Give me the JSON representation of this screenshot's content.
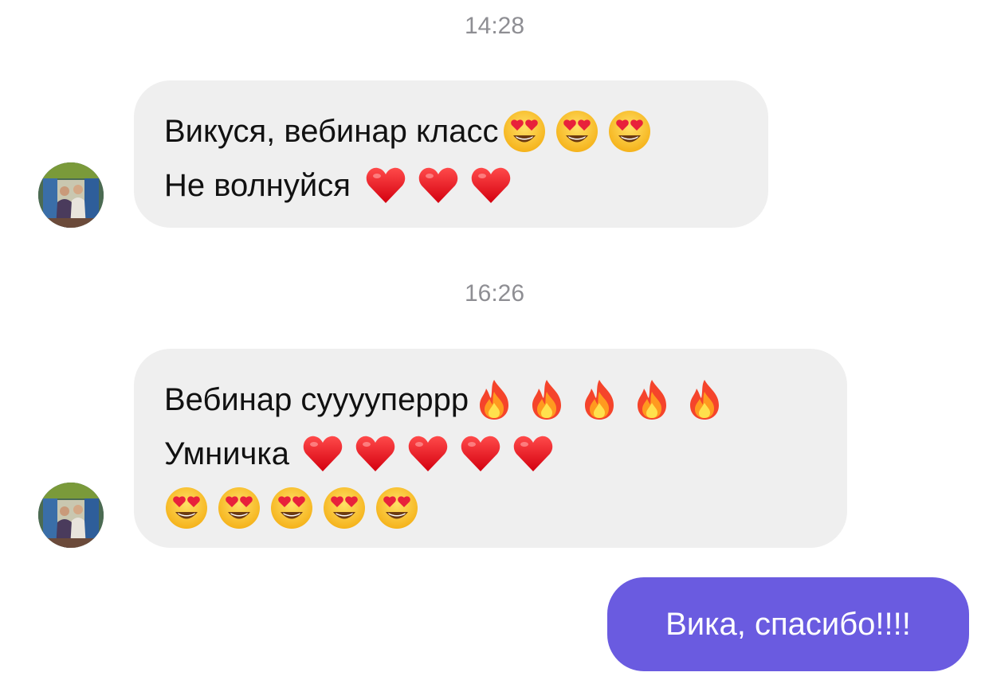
{
  "conversation": {
    "groups": [
      {
        "timestamp": "14:28",
        "message": {
          "lines": [
            {
              "text": "Викуся, вебинар класс",
              "emojis": [
                "heart-eyes-emoji",
                "heart-eyes-emoji",
                "heart-eyes-emoji"
              ]
            },
            {
              "text": "Не волнуйся",
              "emojis": [
                "red-heart-emoji",
                "red-heart-emoji",
                "red-heart-emoji"
              ]
            }
          ]
        }
      },
      {
        "timestamp": "16:26",
        "message": {
          "lines": [
            {
              "text": "Вебинар сууууперрр",
              "emojis": [
                "fire-emoji",
                "fire-emoji",
                "fire-emoji",
                "fire-emoji",
                "fire-emoji"
              ]
            },
            {
              "text": "Умничка",
              "emojis": [
                "red-heart-emoji",
                "red-heart-emoji",
                "red-heart-emoji",
                "red-heart-emoji",
                "red-heart-emoji"
              ]
            },
            {
              "text": "",
              "emojis": [
                "heart-eyes-emoji",
                "heart-eyes-emoji",
                "heart-eyes-emoji",
                "heart-eyes-emoji",
                "heart-eyes-emoji"
              ]
            }
          ]
        }
      }
    ],
    "outgoing": {
      "text": "Вика, спасибо!!!!"
    }
  },
  "colors": {
    "incoming_bubble": "#efefef",
    "outgoing_bubble": "#6a5be0",
    "timestamp": "#8e8e93"
  },
  "icons": {
    "avatar": "contact-photo-avatar"
  }
}
